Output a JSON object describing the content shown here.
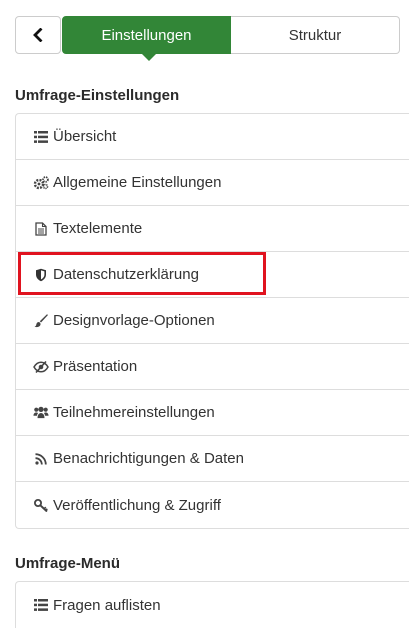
{
  "tabs": {
    "settings_label": "Einstellungen",
    "structure_label": "Struktur"
  },
  "survey_settings": {
    "title": "Umfrage-Einstellungen",
    "items": [
      {
        "label": "Übersicht",
        "icon": "list-icon"
      },
      {
        "label": "Allgemeine Einstellungen",
        "icon": "gears-icon"
      },
      {
        "label": "Textelemente",
        "icon": "document-icon"
      },
      {
        "label": "Datenschutzerklärung",
        "icon": "shield-icon"
      },
      {
        "label": "Designvorlage-Optionen",
        "icon": "paintbrush-icon"
      },
      {
        "label": "Präsentation",
        "icon": "eye-slash-icon"
      },
      {
        "label": "Teilnehmereinstellungen",
        "icon": "users-icon"
      },
      {
        "label": "Benachrichtigungen & Daten",
        "icon": "rss-icon"
      },
      {
        "label": "Veröffentlichung & Zugriff",
        "icon": "key-icon"
      }
    ]
  },
  "survey_menu": {
    "title": "Umfrage-Menü",
    "items": [
      {
        "label": "Fragen auflisten",
        "icon": "list-icon"
      }
    ]
  },
  "colors": {
    "accent_green": "#328637",
    "highlight_red": "#e0131f"
  }
}
